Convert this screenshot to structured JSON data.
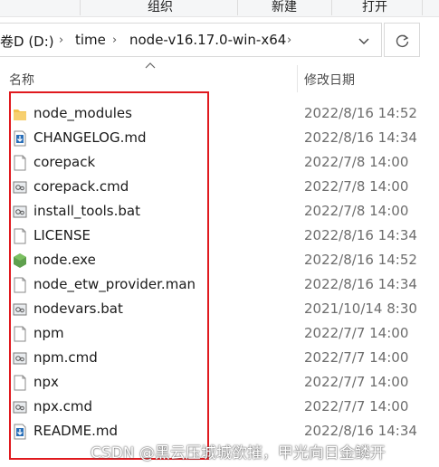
{
  "ribbon": {
    "groups": [
      "组织",
      "新建",
      "打开"
    ]
  },
  "address": {
    "segments": [
      "卷D (D:)",
      "time",
      "node-v16.17.0-win-x64"
    ],
    "separator": "›"
  },
  "header": {
    "name_label": "名称",
    "date_label": "修改日期"
  },
  "files": [
    {
      "name": "node_modules",
      "date": "2022/8/16 14:52",
      "icon": "folder-icon"
    },
    {
      "name": "CHANGELOG.md",
      "date": "2022/8/16 14:34",
      "icon": "md-file-icon"
    },
    {
      "name": "corepack",
      "date": "2022/7/8 14:00",
      "icon": "file-icon"
    },
    {
      "name": "corepack.cmd",
      "date": "2022/7/8 14:00",
      "icon": "cmd-file-icon"
    },
    {
      "name": "install_tools.bat",
      "date": "2022/7/8 14:00",
      "icon": "bat-file-icon"
    },
    {
      "name": "LICENSE",
      "date": "2022/8/16 14:34",
      "icon": "file-icon"
    },
    {
      "name": "node.exe",
      "date": "2022/8/16 14:52",
      "icon": "node-exe-icon"
    },
    {
      "name": "node_etw_provider.man",
      "date": "2022/8/16 14:34",
      "icon": "file-icon"
    },
    {
      "name": "nodevars.bat",
      "date": "2021/10/14 8:30",
      "icon": "bat-file-icon"
    },
    {
      "name": "npm",
      "date": "2022/7/7 14:00",
      "icon": "file-icon"
    },
    {
      "name": "npm.cmd",
      "date": "2022/7/7 14:00",
      "icon": "cmd-file-icon"
    },
    {
      "name": "npx",
      "date": "2022/7/7 14:00",
      "icon": "file-icon"
    },
    {
      "name": "npx.cmd",
      "date": "2022/7/7 14:00",
      "icon": "cmd-file-icon"
    },
    {
      "name": "README.md",
      "date": "2022/8/16 14:34",
      "icon": "md-file-icon"
    }
  ],
  "watermark": "CSDN @黑云压城城欲摧，甲光向日金鳞开",
  "colors": {
    "highlight": "#e0191e",
    "folder": "#f2c14e",
    "node": "#5fa04e"
  }
}
